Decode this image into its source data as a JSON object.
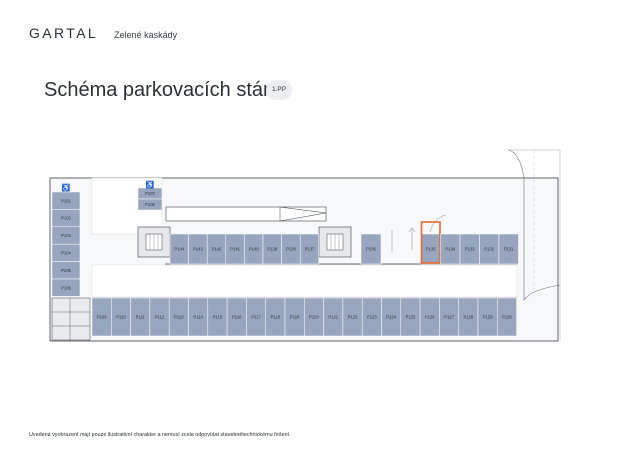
{
  "header": {
    "logo": "GARTAL",
    "project": "Zelené kaskády"
  },
  "title": "Schéma parkovacích stání",
  "floor": "1.PP",
  "colors": {
    "space_fill": "#97a6be",
    "highlight": "#e8692d",
    "wall": "#3a3f47"
  },
  "parking": {
    "left_column": [
      "P101",
      "P102",
      "P103",
      "P104",
      "P105",
      "P106"
    ],
    "middle_top": [
      "P107",
      "P108"
    ],
    "upper_row_left": [
      "P144",
      "P143",
      "P142",
      "P141",
      "P140",
      "P139",
      "P138",
      "P137"
    ],
    "upper_row_mid": "P136",
    "upper_row_right": [
      "P135",
      "P134",
      "P133",
      "P132",
      "P131"
    ],
    "lower_row": [
      "P109",
      "P110",
      "P111",
      "P112",
      "P113",
      "P114",
      "P115",
      "P116",
      "P117",
      "P118",
      "P119",
      "P120",
      "P121",
      "P122",
      "P123",
      "P124",
      "P125",
      "P126",
      "P127",
      "P128",
      "P129",
      "P130"
    ],
    "highlighted": "P135"
  },
  "icons": {
    "accessible": "wheelchair-icon",
    "stairs": "stairwell-icon"
  },
  "disclaimer": "Uvedená vyobrazení mají pouze ilustrativní charakter a nemusí zcela odpovídat stavebnětechnickému řešení."
}
